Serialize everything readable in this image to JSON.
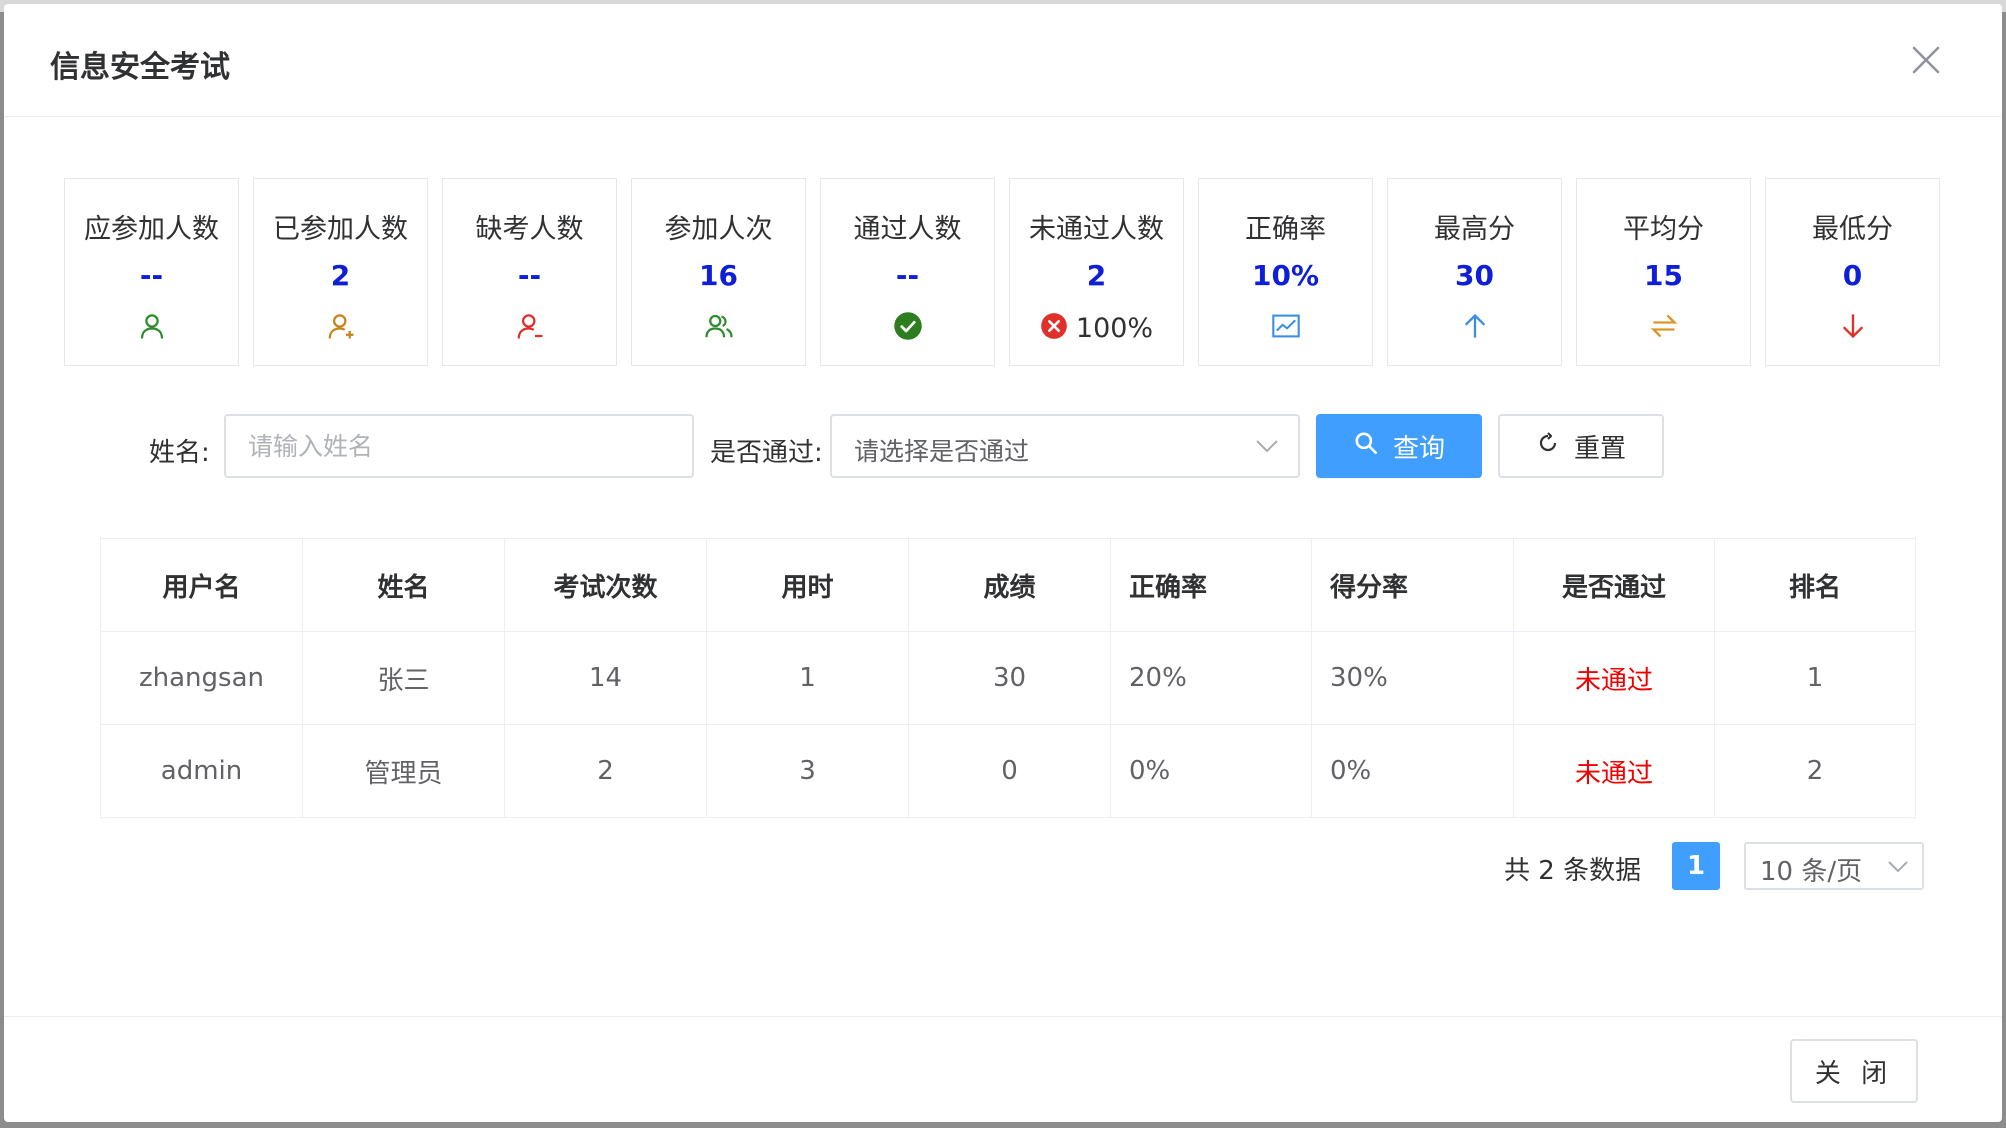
{
  "dialog": {
    "title": "信息安全考试"
  },
  "stats": [
    {
      "label": "应参加人数",
      "value": "--",
      "icon": "user-icon",
      "icon_color": "#2e8b2e"
    },
    {
      "label": "已参加人数",
      "value": "2",
      "icon": "user-add-icon",
      "icon_color": "#c8841a"
    },
    {
      "label": "缺考人数",
      "value": "--",
      "icon": "user-remove-icon",
      "icon_color": "#e0302a"
    },
    {
      "label": "参加人次",
      "value": "16",
      "icon": "users-icon",
      "icon_color": "#2e8b2e"
    },
    {
      "label": "通过人数",
      "value": "--",
      "icon": "check-circle-icon",
      "icon_color": "#2e7d1e"
    },
    {
      "label": "未通过人数",
      "value": "2",
      "icon": "close-circle-icon",
      "icon_color": "#e0302a",
      "sub": "100%"
    },
    {
      "label": "正确率",
      "value": "10%",
      "icon": "line-chart-icon",
      "icon_color": "#3a8ee6"
    },
    {
      "label": "最高分",
      "value": "30",
      "icon": "arrow-up-icon",
      "icon_color": "#3a8ee6"
    },
    {
      "label": "平均分",
      "value": "15",
      "icon": "swap-icon",
      "icon_color": "#d9962b"
    },
    {
      "label": "最低分",
      "value": "0",
      "icon": "arrow-down-icon",
      "icon_color": "#e0302a"
    }
  ],
  "filters": {
    "name_label": "姓名:",
    "name_placeholder": "请输入姓名",
    "pass_label": "是否通过:",
    "pass_placeholder": "请选择是否通过",
    "search_label": "查询",
    "reset_label": "重置"
  },
  "table": {
    "columns": [
      "用户名",
      "姓名",
      "考试次数",
      "用时",
      "成绩",
      "正确率",
      "得分率",
      "是否通过",
      "排名"
    ],
    "rows": [
      [
        "zhangsan",
        "张三",
        "14",
        "1",
        "30",
        "20%",
        "30%",
        "未通过",
        "1"
      ],
      [
        "admin",
        "管理员",
        "2",
        "3",
        "0",
        "0%",
        "0%",
        "未通过",
        "2"
      ]
    ]
  },
  "pagination": {
    "total_text": "共 2 条数据",
    "current_page": "1",
    "page_size": "10 条/页"
  },
  "footer": {
    "close_label": "关 闭"
  },
  "colors": {
    "primary": "#409eff",
    "stat_value": "#0f1fd8",
    "fail": "#f00000"
  }
}
